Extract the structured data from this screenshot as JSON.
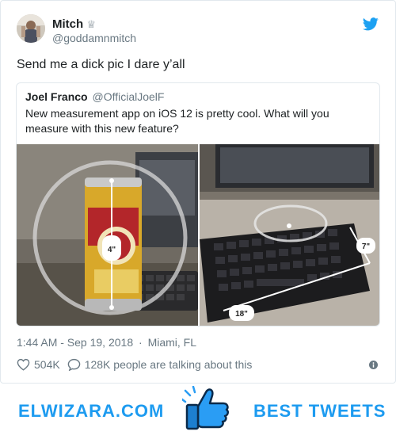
{
  "tweet": {
    "author_name": "Mitch",
    "author_badge": "♕",
    "author_handle": "@goddamnmitch",
    "text": "Send me a dick pic I dare y’all",
    "timestamp": "1:44 AM - Sep 19, 2018",
    "separator": "·",
    "location": "Miami, FL",
    "likes": "504K",
    "talking": "128K people are talking about this",
    "icons": {
      "logo": "twitter-bird-icon",
      "like": "heart-icon",
      "reply": "speech-bubble-icon",
      "info": "info-icon"
    },
    "accent_color": "#1da1f2"
  },
  "quoted_tweet": {
    "author_name": "Joel Franco",
    "author_handle": "@OfficialJoelF",
    "text": "New measurement app on iOS 12 is pretty cool. What will you measure with this new feature?",
    "media": {
      "left_label": "4\"",
      "right_top_label": "7\"",
      "right_bottom_label": "18\""
    }
  },
  "footer": {
    "left_text": "ELWIZARA.COM",
    "right_text": "BEST TWEETS",
    "icon": "thumbs-up-icon",
    "brand_color": "#1d9bf0"
  }
}
